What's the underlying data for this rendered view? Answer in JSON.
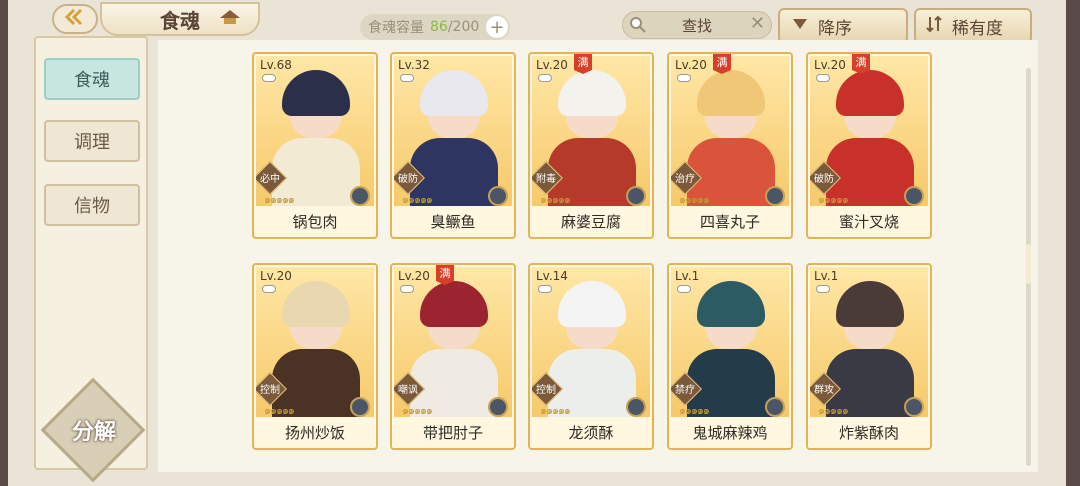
{
  "header": {
    "title": "食魂",
    "capacity_label": "食魂容量",
    "capacity_current": "86",
    "capacity_max": "/200",
    "plus": "+",
    "search_placeholder": "查找",
    "sort_desc": "降序",
    "sort_rarity": "稀有度"
  },
  "sidebar": {
    "items": [
      {
        "label": "食魂",
        "active": true
      },
      {
        "label": "调理",
        "active": false
      },
      {
        "label": "信物",
        "active": false
      }
    ],
    "decompose": "分解"
  },
  "cards": [
    {
      "level": "Lv.68",
      "name": "锅包肉",
      "role": "必中",
      "max": false,
      "hair": "#2b2f4a",
      "outfit": "#f2ead2"
    },
    {
      "level": "Lv.32",
      "name": "臭鳜鱼",
      "role": "破防",
      "max": false,
      "hair": "#e8e8ee",
      "outfit": "#2f3561"
    },
    {
      "level": "Lv.20",
      "name": "麻婆豆腐",
      "role": "附毒",
      "max": true,
      "hair": "#f4f2ec",
      "outfit": "#b63a2a"
    },
    {
      "level": "Lv.20",
      "name": "四喜丸子",
      "role": "治疗",
      "max": true,
      "hair": "#f0c777",
      "outfit": "#d9543a"
    },
    {
      "level": "Lv.20",
      "name": "蜜汁叉烧",
      "role": "破防",
      "max": true,
      "hair": "#c8302a",
      "outfit": "#c8302a"
    },
    {
      "level": "Lv.20",
      "name": "扬州炒饭",
      "role": "控制",
      "max": false,
      "hair": "#e9d7b0",
      "outfit": "#4a3324"
    },
    {
      "level": "Lv.20",
      "name": "带把肘子",
      "role": "嘲讽",
      "max": true,
      "hair": "#9c2430",
      "outfit": "#f0ebe2"
    },
    {
      "level": "Lv.14",
      "name": "龙须酥",
      "role": "控制",
      "max": false,
      "hair": "#f4f4f4",
      "outfit": "#ecefe9"
    },
    {
      "level": "Lv.1",
      "name": "鬼城麻辣鸡",
      "role": "禁疗",
      "max": false,
      "hair": "#2c5b63",
      "outfit": "#243c4a"
    },
    {
      "level": "Lv.1",
      "name": "炸紫酥肉",
      "role": "群攻",
      "max": false,
      "hair": "#4a3a38",
      "outfit": "#3a3a44"
    }
  ],
  "max_label": "满",
  "stars": "๑๑๑๑๑"
}
